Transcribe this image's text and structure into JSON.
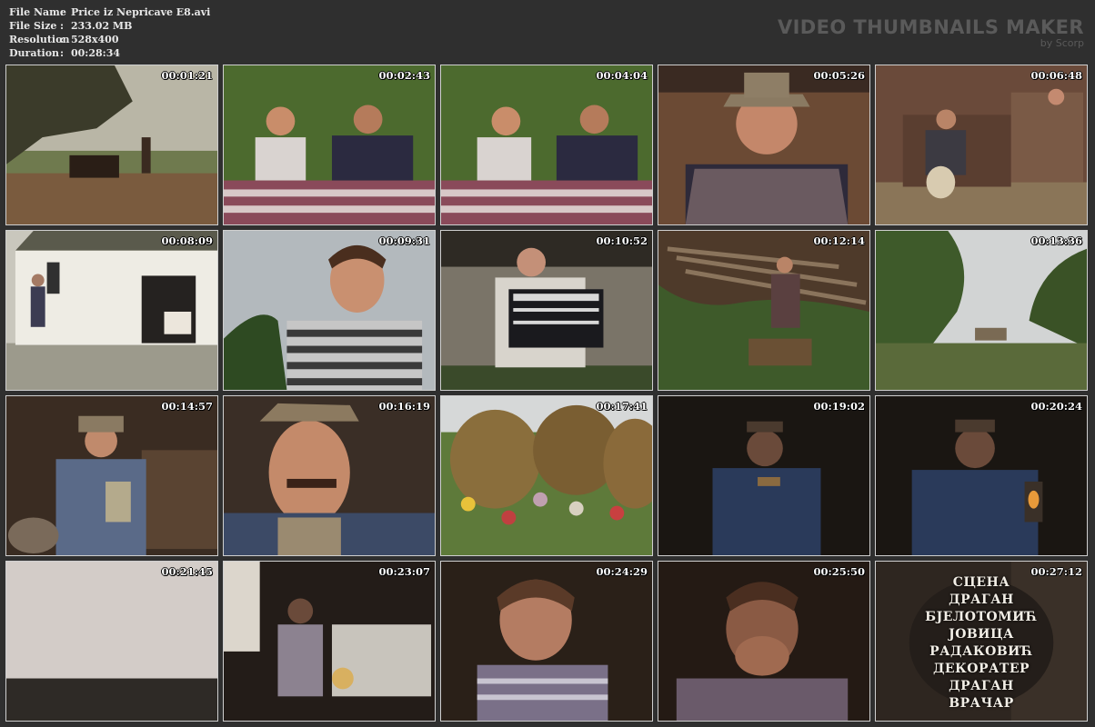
{
  "file_info": {
    "rows": [
      {
        "key": "File Name",
        "sep": ":",
        "value": "Price iz Nepricave E8.avi"
      },
      {
        "key": "File Size",
        "sep": ":",
        "value": "233.02 MB"
      },
      {
        "key": "Resolution",
        "sep": ":",
        "value": "528x400"
      },
      {
        "key": "Duration",
        "sep": ":",
        "value": "00:28:34"
      }
    ]
  },
  "brand": {
    "title": "VIDEO THUMBNAILS MAKER",
    "by": "by Scorp"
  },
  "thumbnails": [
    {
      "timestamp": "00:01:21"
    },
    {
      "timestamp": "00:02:43"
    },
    {
      "timestamp": "00:04:04"
    },
    {
      "timestamp": "00:05:26"
    },
    {
      "timestamp": "00:06:48"
    },
    {
      "timestamp": "00:08:09"
    },
    {
      "timestamp": "00:09:31"
    },
    {
      "timestamp": "00:10:52"
    },
    {
      "timestamp": "00:12:14"
    },
    {
      "timestamp": "00:13:36"
    },
    {
      "timestamp": "00:14:57"
    },
    {
      "timestamp": "00:16:19"
    },
    {
      "timestamp": "00:17:41"
    },
    {
      "timestamp": "00:19:02"
    },
    {
      "timestamp": "00:20:24"
    },
    {
      "timestamp": "00:21:45"
    },
    {
      "timestamp": "00:23:07"
    },
    {
      "timestamp": "00:24:29"
    },
    {
      "timestamp": "00:25:50"
    },
    {
      "timestamp": "00:27:12"
    }
  ],
  "credits": {
    "lines": [
      "СЦЕНА",
      "ДРАГАН",
      "БЈЕЛОТОМИЋ",
      "ЈОВИЦА",
      "РАДАКОВИЋ",
      "ДЕКОРАТЕР",
      "ДРАГАН",
      "ВРАЧАР"
    ]
  }
}
